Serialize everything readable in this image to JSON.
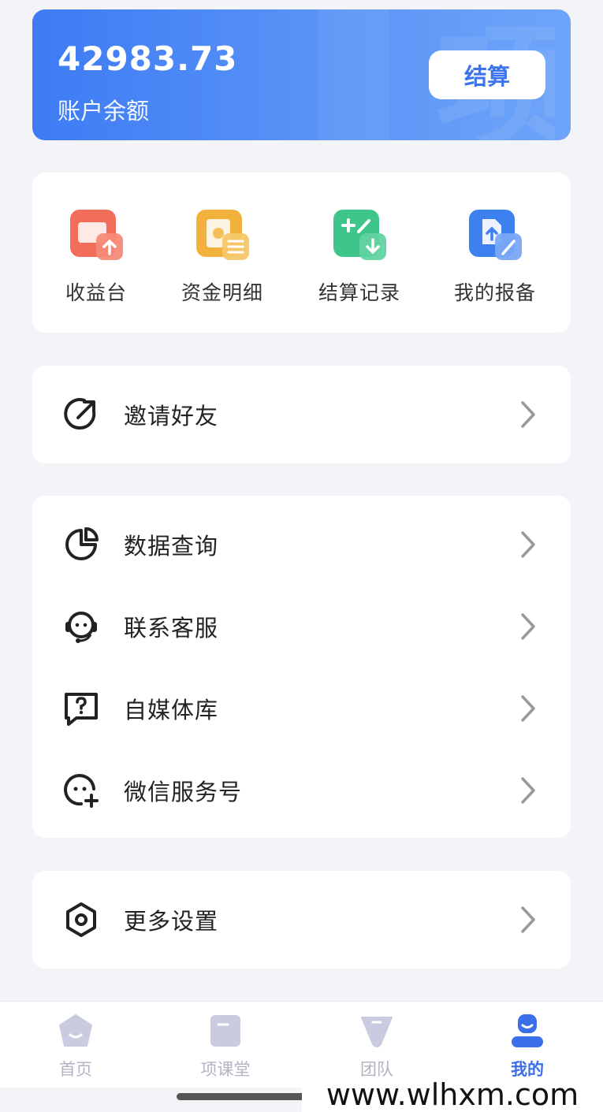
{
  "account": {
    "balance": "42983.73",
    "balance_label": "账户余额",
    "settle_button": "结算"
  },
  "quick_actions": [
    {
      "label": "收益台",
      "icon": "wallet-upload-icon",
      "color": "#f26d5a"
    },
    {
      "label": "资金明细",
      "icon": "document-list-icon",
      "color": "#f2b13c"
    },
    {
      "label": "结算记录",
      "icon": "calculator-download-icon",
      "color": "#3ec58a"
    },
    {
      "label": "我的报备",
      "icon": "file-upload-icon",
      "color": "#3e80f0"
    }
  ],
  "invite": {
    "label": "邀请好友",
    "icon": "share-arrow-icon"
  },
  "menu": [
    {
      "label": "数据查询",
      "icon": "pie-chart-icon"
    },
    {
      "label": "联系客服",
      "icon": "headset-icon"
    },
    {
      "label": "自媒体库",
      "icon": "question-chat-icon"
    },
    {
      "label": "微信服务号",
      "icon": "chat-add-icon"
    }
  ],
  "settings": {
    "label": "更多设置",
    "icon": "hexagon-gear-icon"
  },
  "tabbar": [
    {
      "label": "首页",
      "icon": "home-icon",
      "active": false
    },
    {
      "label": "项课堂",
      "icon": "book-icon",
      "active": false
    },
    {
      "label": "团队",
      "icon": "team-icon",
      "active": false
    },
    {
      "label": "我的",
      "icon": "profile-icon",
      "active": true
    }
  ],
  "colors": {
    "accent": "#3b6fea",
    "card_gradient_start": "#3d7bf4",
    "card_gradient_end": "#6ea4f8",
    "background": "#f3f4f8",
    "inactive_tab": "#b3b3c3"
  },
  "watermark": "www.wlhxm.com"
}
